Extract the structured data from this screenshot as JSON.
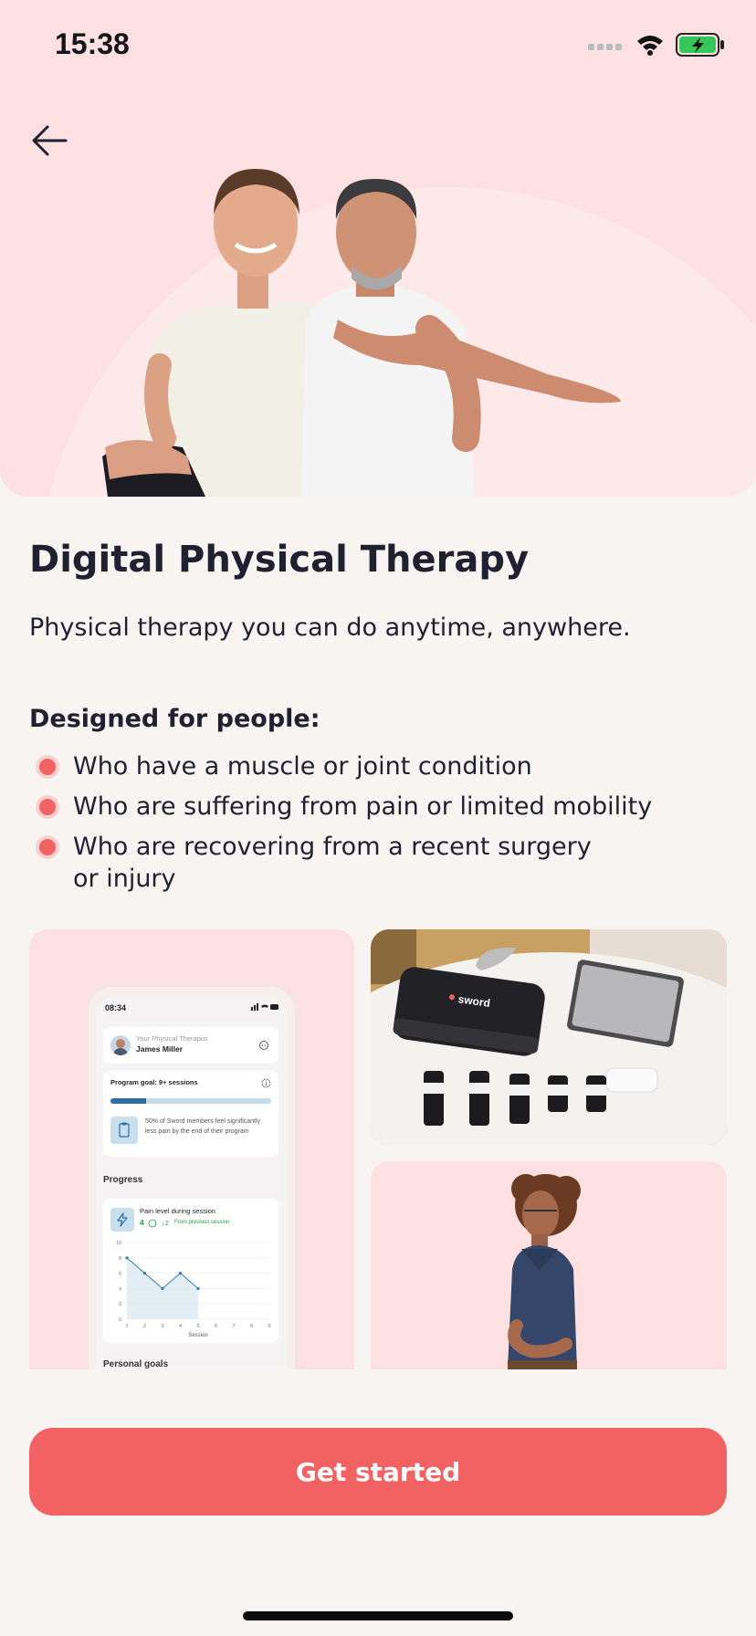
{
  "status_bar": {
    "time": "15:38"
  },
  "hero": {
    "image_alt": "two people stretching"
  },
  "content": {
    "title": "Digital Physical Therapy",
    "subtitle": "Physical therapy you can do anytime, anywhere.",
    "designed_heading": "Designed for people:",
    "bullets": [
      "Who have a muscle or joint condition",
      "Who are suffering from pain or limited mobility",
      "Who are recovering from a recent surgery or injury"
    ]
  },
  "app_preview": {
    "time": "08:34",
    "therapist_label": "Your Physical Therapist",
    "therapist_name": "James Miller",
    "program_goal": "Program goal: 9+ sessions",
    "program_progress": 0.22,
    "stat_text": "50% of Sword members feel significantly less pain by the end of their program",
    "progress_heading": "Progress",
    "pain_title": "Pain level during session",
    "pain_value": "4",
    "pain_change": "↓2",
    "pain_change_label": "From previous session",
    "chart_data": {
      "type": "line",
      "x": [
        1,
        2,
        3,
        4,
        5
      ],
      "y": [
        8,
        6,
        4,
        6,
        4
      ],
      "x_ticks": [
        "1",
        "2",
        "3",
        "4",
        "5",
        "6",
        "7",
        "8",
        "9"
      ],
      "y_ticks": [
        "0",
        "2",
        "4",
        "6",
        "8",
        "10"
      ],
      "xlabel": "Session",
      "xlim": [
        1,
        9
      ],
      "ylim": [
        0,
        10
      ]
    },
    "personal_goals_heading": "Personal goals"
  },
  "kit": {
    "brand": "sword"
  },
  "cta": {
    "label": "Get started"
  },
  "colors": {
    "accent": "#f26262",
    "hero_bg": "#fde0e1",
    "page_bg": "#f8f4f2"
  }
}
